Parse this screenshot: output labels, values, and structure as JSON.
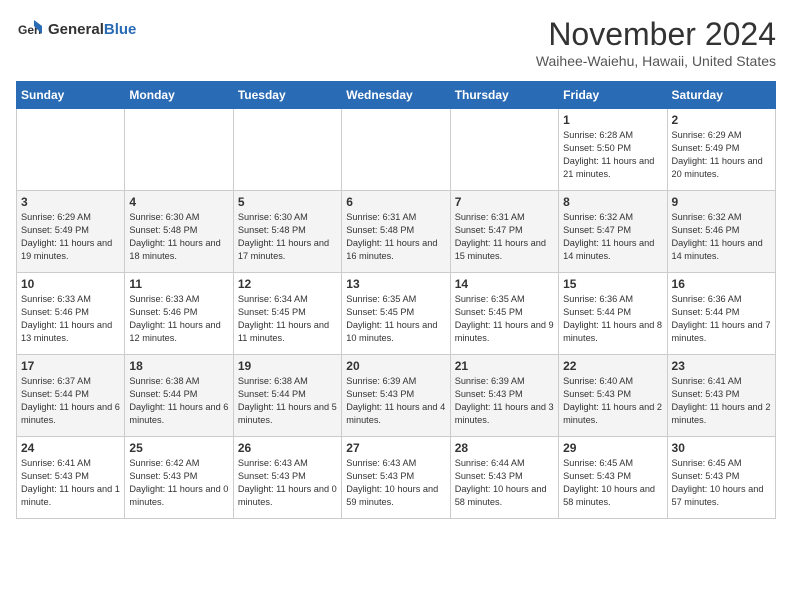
{
  "header": {
    "logo_general": "General",
    "logo_blue": "Blue",
    "month_title": "November 2024",
    "location": "Waihee-Waiehu, Hawaii, United States"
  },
  "days_of_week": [
    "Sunday",
    "Monday",
    "Tuesday",
    "Wednesday",
    "Thursday",
    "Friday",
    "Saturday"
  ],
  "weeks": [
    [
      {
        "day": "",
        "info": ""
      },
      {
        "day": "",
        "info": ""
      },
      {
        "day": "",
        "info": ""
      },
      {
        "day": "",
        "info": ""
      },
      {
        "day": "",
        "info": ""
      },
      {
        "day": "1",
        "info": "Sunrise: 6:28 AM\nSunset: 5:50 PM\nDaylight: 11 hours and 21 minutes."
      },
      {
        "day": "2",
        "info": "Sunrise: 6:29 AM\nSunset: 5:49 PM\nDaylight: 11 hours and 20 minutes."
      }
    ],
    [
      {
        "day": "3",
        "info": "Sunrise: 6:29 AM\nSunset: 5:49 PM\nDaylight: 11 hours and 19 minutes."
      },
      {
        "day": "4",
        "info": "Sunrise: 6:30 AM\nSunset: 5:48 PM\nDaylight: 11 hours and 18 minutes."
      },
      {
        "day": "5",
        "info": "Sunrise: 6:30 AM\nSunset: 5:48 PM\nDaylight: 11 hours and 17 minutes."
      },
      {
        "day": "6",
        "info": "Sunrise: 6:31 AM\nSunset: 5:48 PM\nDaylight: 11 hours and 16 minutes."
      },
      {
        "day": "7",
        "info": "Sunrise: 6:31 AM\nSunset: 5:47 PM\nDaylight: 11 hours and 15 minutes."
      },
      {
        "day": "8",
        "info": "Sunrise: 6:32 AM\nSunset: 5:47 PM\nDaylight: 11 hours and 14 minutes."
      },
      {
        "day": "9",
        "info": "Sunrise: 6:32 AM\nSunset: 5:46 PM\nDaylight: 11 hours and 14 minutes."
      }
    ],
    [
      {
        "day": "10",
        "info": "Sunrise: 6:33 AM\nSunset: 5:46 PM\nDaylight: 11 hours and 13 minutes."
      },
      {
        "day": "11",
        "info": "Sunrise: 6:33 AM\nSunset: 5:46 PM\nDaylight: 11 hours and 12 minutes."
      },
      {
        "day": "12",
        "info": "Sunrise: 6:34 AM\nSunset: 5:45 PM\nDaylight: 11 hours and 11 minutes."
      },
      {
        "day": "13",
        "info": "Sunrise: 6:35 AM\nSunset: 5:45 PM\nDaylight: 11 hours and 10 minutes."
      },
      {
        "day": "14",
        "info": "Sunrise: 6:35 AM\nSunset: 5:45 PM\nDaylight: 11 hours and 9 minutes."
      },
      {
        "day": "15",
        "info": "Sunrise: 6:36 AM\nSunset: 5:44 PM\nDaylight: 11 hours and 8 minutes."
      },
      {
        "day": "16",
        "info": "Sunrise: 6:36 AM\nSunset: 5:44 PM\nDaylight: 11 hours and 7 minutes."
      }
    ],
    [
      {
        "day": "17",
        "info": "Sunrise: 6:37 AM\nSunset: 5:44 PM\nDaylight: 11 hours and 6 minutes."
      },
      {
        "day": "18",
        "info": "Sunrise: 6:38 AM\nSunset: 5:44 PM\nDaylight: 11 hours and 6 minutes."
      },
      {
        "day": "19",
        "info": "Sunrise: 6:38 AM\nSunset: 5:44 PM\nDaylight: 11 hours and 5 minutes."
      },
      {
        "day": "20",
        "info": "Sunrise: 6:39 AM\nSunset: 5:43 PM\nDaylight: 11 hours and 4 minutes."
      },
      {
        "day": "21",
        "info": "Sunrise: 6:39 AM\nSunset: 5:43 PM\nDaylight: 11 hours and 3 minutes."
      },
      {
        "day": "22",
        "info": "Sunrise: 6:40 AM\nSunset: 5:43 PM\nDaylight: 11 hours and 2 minutes."
      },
      {
        "day": "23",
        "info": "Sunrise: 6:41 AM\nSunset: 5:43 PM\nDaylight: 11 hours and 2 minutes."
      }
    ],
    [
      {
        "day": "24",
        "info": "Sunrise: 6:41 AM\nSunset: 5:43 PM\nDaylight: 11 hours and 1 minute."
      },
      {
        "day": "25",
        "info": "Sunrise: 6:42 AM\nSunset: 5:43 PM\nDaylight: 11 hours and 0 minutes."
      },
      {
        "day": "26",
        "info": "Sunrise: 6:43 AM\nSunset: 5:43 PM\nDaylight: 11 hours and 0 minutes."
      },
      {
        "day": "27",
        "info": "Sunrise: 6:43 AM\nSunset: 5:43 PM\nDaylight: 10 hours and 59 minutes."
      },
      {
        "day": "28",
        "info": "Sunrise: 6:44 AM\nSunset: 5:43 PM\nDaylight: 10 hours and 58 minutes."
      },
      {
        "day": "29",
        "info": "Sunrise: 6:45 AM\nSunset: 5:43 PM\nDaylight: 10 hours and 58 minutes."
      },
      {
        "day": "30",
        "info": "Sunrise: 6:45 AM\nSunset: 5:43 PM\nDaylight: 10 hours and 57 minutes."
      }
    ]
  ]
}
